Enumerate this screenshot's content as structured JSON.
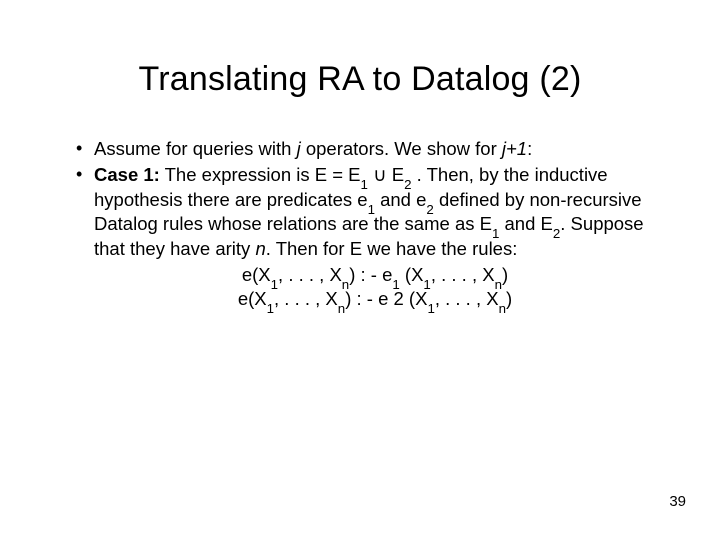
{
  "title": "Translating RA to Datalog (2)",
  "bullet1": {
    "t1": "Assume for queries with ",
    "j": "j",
    "t2": " operators. We show for ",
    "jp1": "j+1",
    "t3": ":"
  },
  "bullet2": {
    "case_label": "Case 1:",
    "t1": " The expression is E = E",
    "s1": "1",
    "t2": " ",
    "union": "∪",
    "t3": " E",
    "s2": "2",
    "t4": " . Then, by the inductive hypothesis there are predicates e",
    "s3": "1",
    "t5": " and e",
    "s4": "2",
    "t6": " defined by non-recursive Datalog rules whose relations are the same as E",
    "s5": "1",
    "t7": " and E",
    "s6": "2",
    "t8": ". Suppose that they have arity ",
    "n": "n",
    "t9": ". Then for E we have the rules:"
  },
  "rule1": {
    "a": "e(X",
    "s1": "1",
    "b": ", . . . , X",
    "s2": "n",
    "c": ") : - e",
    "s3": "1",
    "d": " (X",
    "s4": "1",
    "e": ", . . . , X",
    "s5": "n",
    "f": ")"
  },
  "rule2": {
    "a": "e(X",
    "s1": "1",
    "b": ", . . . , X",
    "s2": "n",
    "c": ") : - e 2 (X",
    "s3": "1",
    "d": ", . . . , X",
    "s4": "n",
    "e": ")"
  },
  "page_number": "39"
}
